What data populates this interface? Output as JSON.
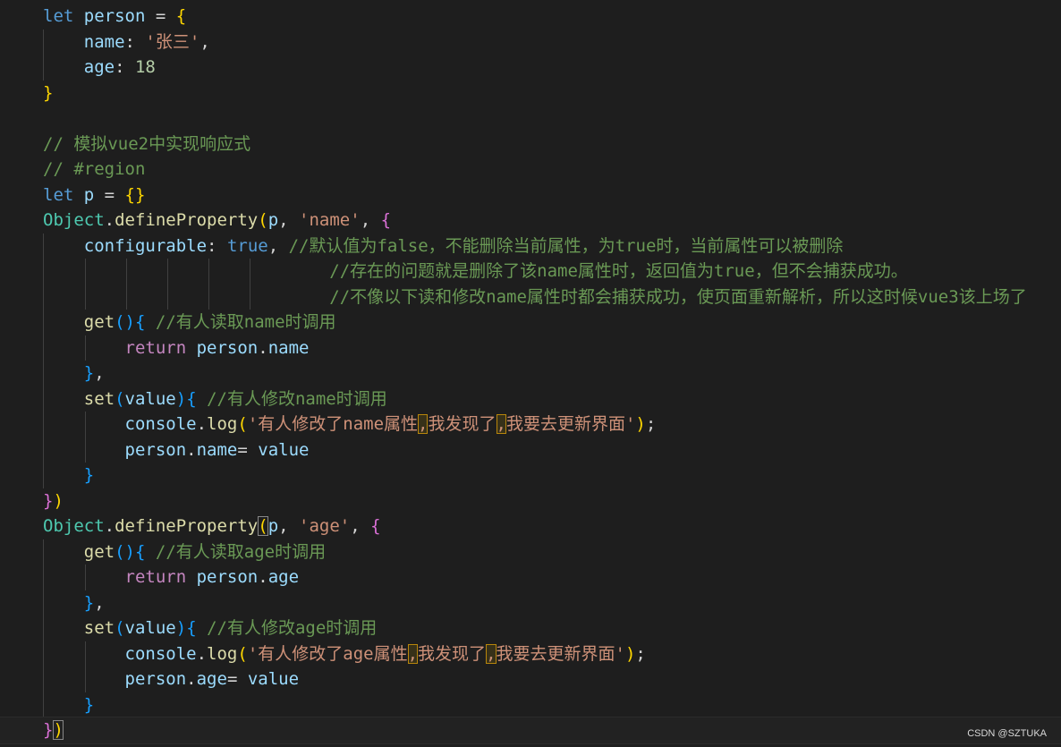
{
  "editor": {
    "language": "javascript",
    "lines": [
      [
        {
          "t": "let ",
          "c": "kw"
        },
        {
          "t": "person",
          "c": "var"
        },
        {
          "t": " = ",
          "c": "op"
        },
        {
          "t": "{",
          "c": "b1"
        }
      ],
      [
        {
          "t": "    "
        },
        {
          "t": "name",
          "c": "var"
        },
        {
          "t": ": ",
          "c": "op"
        },
        {
          "t": "'张三'",
          "c": "str"
        },
        {
          "t": ",",
          "c": "op"
        }
      ],
      [
        {
          "t": "    "
        },
        {
          "t": "age",
          "c": "var"
        },
        {
          "t": ": ",
          "c": "op"
        },
        {
          "t": "18",
          "c": "num"
        }
      ],
      [
        {
          "t": "}",
          "c": "b1"
        }
      ],
      [],
      [
        {
          "t": "// 模拟vue2中实现响应式",
          "c": "cmt"
        }
      ],
      [
        {
          "t": "// #region",
          "c": "cmt"
        }
      ],
      [
        {
          "t": "let ",
          "c": "kw"
        },
        {
          "t": "p",
          "c": "var"
        },
        {
          "t": " = ",
          "c": "op"
        },
        {
          "t": "{}",
          "c": "b1"
        }
      ],
      [
        {
          "t": "Object",
          "c": "cls"
        },
        {
          "t": ".",
          "c": "op"
        },
        {
          "t": "defineProperty",
          "c": "fn"
        },
        {
          "t": "(",
          "c": "b1"
        },
        {
          "t": "p",
          "c": "var"
        },
        {
          "t": ", ",
          "c": "op"
        },
        {
          "t": "'name'",
          "c": "str"
        },
        {
          "t": ", ",
          "c": "op"
        },
        {
          "t": "{",
          "c": "b2"
        }
      ],
      [
        {
          "t": "    "
        },
        {
          "t": "configurable",
          "c": "var"
        },
        {
          "t": ": ",
          "c": "op"
        },
        {
          "t": "true",
          "c": "kw"
        },
        {
          "t": ", ",
          "c": "op"
        },
        {
          "t": "//默认值为false，不能删除当前属性，为true时，当前属性可以被删除",
          "c": "cmt"
        }
      ],
      [
        {
          "t": "                            "
        },
        {
          "t": "//存在的问题就是删除了该name属性时，返回值为true，但不会捕获成功。",
          "c": "cmt"
        }
      ],
      [
        {
          "t": "                            "
        },
        {
          "t": "//不像以下读和修改name属性时都会捕获成功，使页面重新解析，所以这时候vue3该上场了",
          "c": "cmt"
        }
      ],
      [
        {
          "t": "    "
        },
        {
          "t": "get",
          "c": "fn"
        },
        {
          "t": "()",
          "c": "b3"
        },
        {
          "t": "{",
          "c": "b3"
        },
        {
          "t": " ",
          "c": "op"
        },
        {
          "t": "//有人读取name时调用",
          "c": "cmt"
        }
      ],
      [
        {
          "t": "        "
        },
        {
          "t": "return ",
          "c": "kw2"
        },
        {
          "t": "person",
          "c": "var"
        },
        {
          "t": ".",
          "c": "op"
        },
        {
          "t": "name",
          "c": "var"
        }
      ],
      [
        {
          "t": "    "
        },
        {
          "t": "}",
          "c": "b3"
        },
        {
          "t": ",",
          "c": "op"
        }
      ],
      [
        {
          "t": "    "
        },
        {
          "t": "set",
          "c": "fn"
        },
        {
          "t": "(",
          "c": "b3"
        },
        {
          "t": "value",
          "c": "var"
        },
        {
          "t": ")",
          "c": "b3"
        },
        {
          "t": "{",
          "c": "b3"
        },
        {
          "t": " ",
          "c": "op"
        },
        {
          "t": "//有人修改name时调用",
          "c": "cmt"
        }
      ],
      [
        {
          "t": "        "
        },
        {
          "t": "console",
          "c": "var"
        },
        {
          "t": ".",
          "c": "op"
        },
        {
          "t": "log",
          "c": "fn"
        },
        {
          "t": "(",
          "c": "b1"
        },
        {
          "t": "'有人修改了name属性",
          "c": "str"
        },
        {
          "t": ",",
          "c": "str",
          "h": "hl"
        },
        {
          "t": "我发现了",
          "c": "str"
        },
        {
          "t": ",",
          "c": "str",
          "h": "hl"
        },
        {
          "t": "我要去更新界面'",
          "c": "str"
        },
        {
          "t": ")",
          "c": "b1"
        },
        {
          "t": ";",
          "c": "op"
        }
      ],
      [
        {
          "t": "        "
        },
        {
          "t": "person",
          "c": "var"
        },
        {
          "t": ".",
          "c": "op"
        },
        {
          "t": "name",
          "c": "var"
        },
        {
          "t": "= ",
          "c": "op"
        },
        {
          "t": "value",
          "c": "var"
        }
      ],
      [
        {
          "t": "    "
        },
        {
          "t": "}",
          "c": "b3"
        }
      ],
      [
        {
          "t": "}",
          "c": "b2"
        },
        {
          "t": ")",
          "c": "b1"
        }
      ],
      [
        {
          "t": "Object",
          "c": "cls"
        },
        {
          "t": ".",
          "c": "op"
        },
        {
          "t": "defineProperty",
          "c": "fn"
        },
        {
          "t": "(",
          "c": "b1",
          "h": "bm"
        },
        {
          "t": "p",
          "c": "var"
        },
        {
          "t": ", ",
          "c": "op"
        },
        {
          "t": "'age'",
          "c": "str"
        },
        {
          "t": ", ",
          "c": "op"
        },
        {
          "t": "{",
          "c": "b2"
        }
      ],
      [
        {
          "t": "    "
        },
        {
          "t": "get",
          "c": "fn"
        },
        {
          "t": "()",
          "c": "b3"
        },
        {
          "t": "{",
          "c": "b3"
        },
        {
          "t": " ",
          "c": "op"
        },
        {
          "t": "//有人读取age时调用",
          "c": "cmt"
        }
      ],
      [
        {
          "t": "        "
        },
        {
          "t": "return ",
          "c": "kw2"
        },
        {
          "t": "person",
          "c": "var"
        },
        {
          "t": ".",
          "c": "op"
        },
        {
          "t": "age",
          "c": "var"
        }
      ],
      [
        {
          "t": "    "
        },
        {
          "t": "}",
          "c": "b3"
        },
        {
          "t": ",",
          "c": "op"
        }
      ],
      [
        {
          "t": "    "
        },
        {
          "t": "set",
          "c": "fn"
        },
        {
          "t": "(",
          "c": "b3"
        },
        {
          "t": "value",
          "c": "var"
        },
        {
          "t": ")",
          "c": "b3"
        },
        {
          "t": "{",
          "c": "b3"
        },
        {
          "t": " ",
          "c": "op"
        },
        {
          "t": "//有人修改age时调用",
          "c": "cmt"
        }
      ],
      [
        {
          "t": "        "
        },
        {
          "t": "console",
          "c": "var"
        },
        {
          "t": ".",
          "c": "op"
        },
        {
          "t": "log",
          "c": "fn"
        },
        {
          "t": "(",
          "c": "b1"
        },
        {
          "t": "'有人修改了age属性",
          "c": "str"
        },
        {
          "t": ",",
          "c": "str",
          "h": "hl"
        },
        {
          "t": "我发现了",
          "c": "str"
        },
        {
          "t": ",",
          "c": "str",
          "h": "hl"
        },
        {
          "t": "我要去更新界面'",
          "c": "str"
        },
        {
          "t": ")",
          "c": "b1"
        },
        {
          "t": ";",
          "c": "op"
        }
      ],
      [
        {
          "t": "        "
        },
        {
          "t": "person",
          "c": "var"
        },
        {
          "t": ".",
          "c": "op"
        },
        {
          "t": "age",
          "c": "var"
        },
        {
          "t": "= ",
          "c": "op"
        },
        {
          "t": "value",
          "c": "var"
        }
      ],
      [
        {
          "t": "    "
        },
        {
          "t": "}",
          "c": "b3"
        }
      ],
      [
        {
          "t": "}",
          "c": "b2"
        },
        {
          "t": ")",
          "c": "b1",
          "h": "bm"
        }
      ]
    ],
    "active_line": 28,
    "colors": {
      "background": "#1e1e1e",
      "keyword": "#569cd6",
      "control_keyword": "#c586c0",
      "variable": "#9cdcfe",
      "function": "#dcdcaa",
      "class": "#4ec9b0",
      "string": "#ce9178",
      "number": "#b5cea8",
      "comment": "#6a9955",
      "bracket_level_1": "#ffd700",
      "bracket_level_2": "#da70d6",
      "bracket_level_3": "#179fff"
    }
  },
  "watermark": "CSDN @SZTUKA"
}
